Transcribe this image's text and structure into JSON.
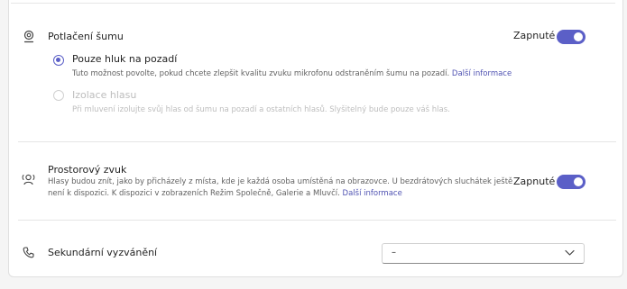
{
  "noise_suppression": {
    "title": "Potlačení šumu",
    "toggle_label": "Zapnuté",
    "toggle_on": true,
    "icon": "noise-suppression-icon",
    "options": [
      {
        "label": "Pouze hluk na pozadí",
        "description": "Tuto možnost povolte, pokud chcete zlepšit kvalitu zvuku mikrofonu odstraněním šumu na pozadí.",
        "link": "Další informace",
        "selected": true,
        "disabled": false
      },
      {
        "label": "Izolace hlasu",
        "description": "Při mluvení izolujte svůj hlas od šumu na pozadí a ostatních hlasů. Slyšitelný bude pouze váš hlas.",
        "selected": false,
        "disabled": true
      }
    ]
  },
  "spatial_audio": {
    "title": "Prostorový zvuk",
    "description_line1": "Hlasy budou znít, jako by přicházely z místa, kde je každá osoba umístěná na obrazovce. U bezdrátových sluchátek ještě",
    "description_line2": "není k dispozici. K dispozici v zobrazeních Režim Společně, Galerie a Mluvčí.",
    "link": "Další informace",
    "toggle_label": "Zapnuté",
    "toggle_on": true,
    "icon": "spatial-audio-icon"
  },
  "secondary_ringer": {
    "title": "Sekundární vyzvánění",
    "selected_value": "–",
    "icon": "phone-icon"
  },
  "colors": {
    "accent": "#5b5fc7",
    "link": "#4f52b2"
  }
}
